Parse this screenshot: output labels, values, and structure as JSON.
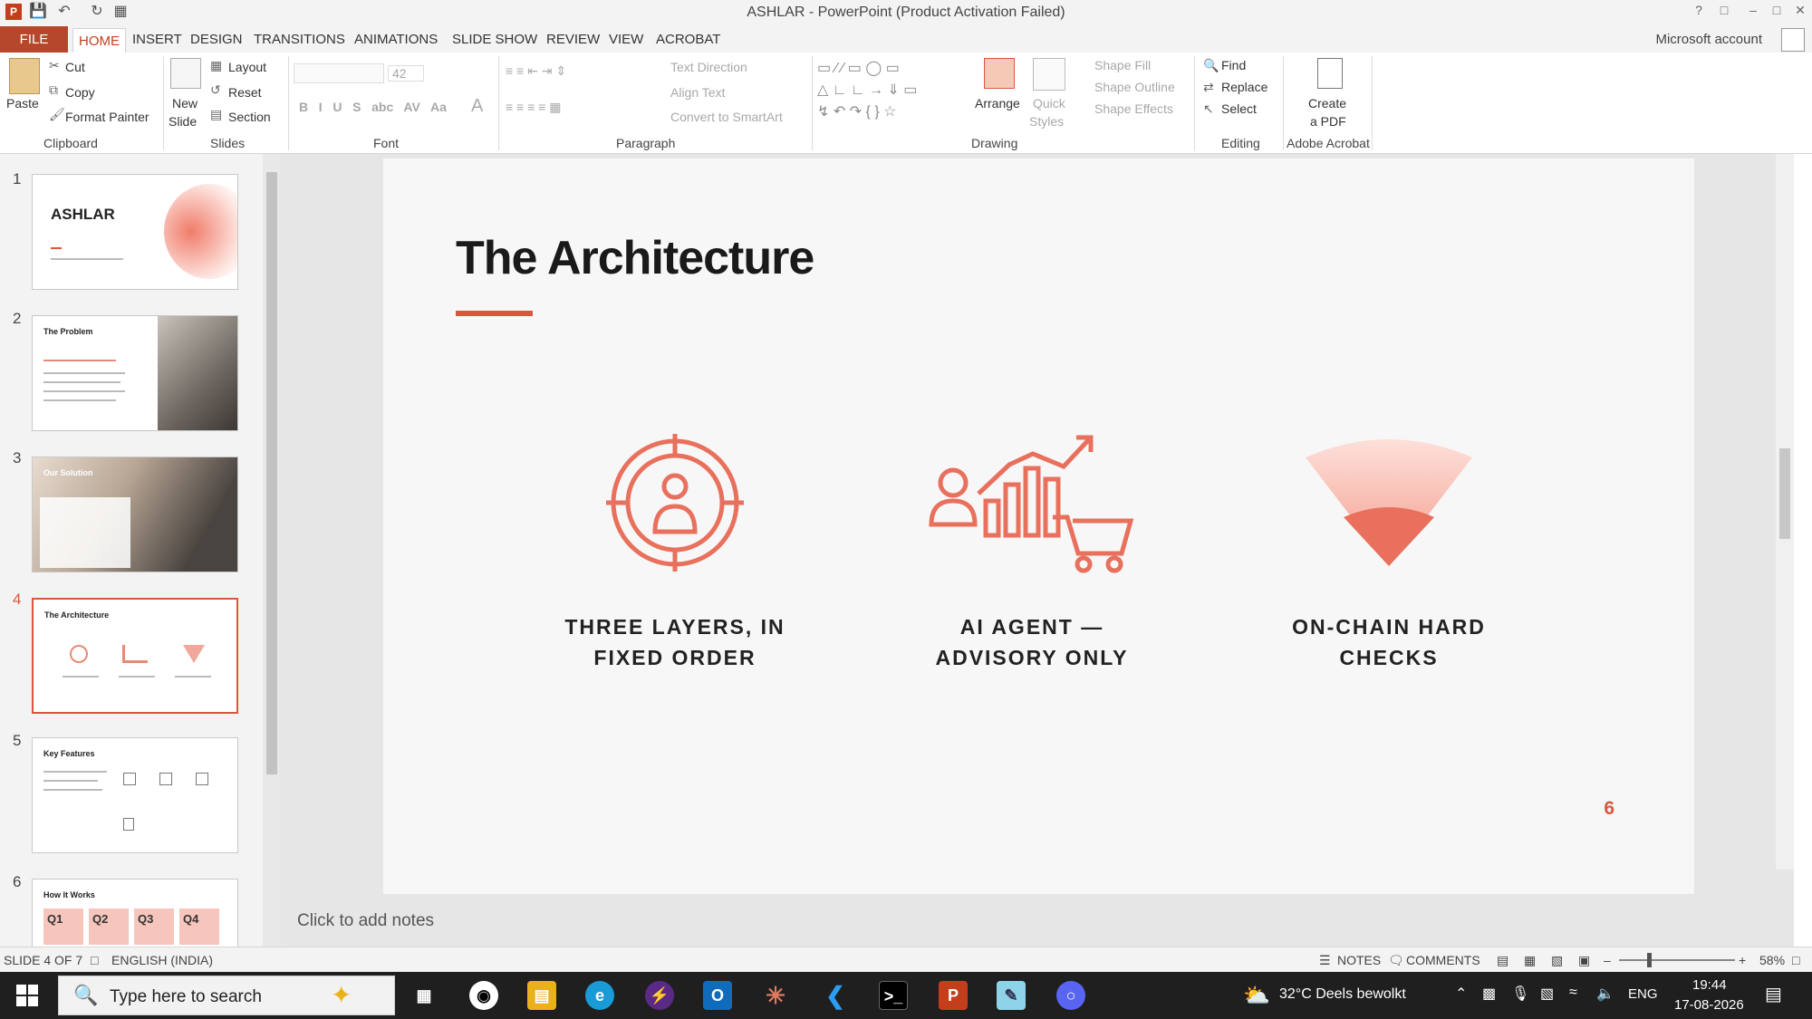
{
  "window": {
    "title": "ASHLAR - PowerPoint (Product Activation Failed)",
    "account": "Microsoft account"
  },
  "tabs": [
    "FILE",
    "HOME",
    "INSERT",
    "DESIGN",
    "TRANSITIONS",
    "ANIMATIONS",
    "SLIDE SHOW",
    "REVIEW",
    "VIEW",
    "ACROBAT"
  ],
  "ribbon": {
    "clipboard": {
      "paste": "Paste",
      "cut": "Cut",
      "copy": "Copy",
      "format_painter": "Format Painter",
      "label": "Clipboard"
    },
    "slides": {
      "new_slide_1": "New",
      "new_slide_2": "Slide",
      "layout": "Layout",
      "reset": "Reset",
      "section": "Section",
      "label": "Slides"
    },
    "font": {
      "size": "42",
      "label": "Font"
    },
    "paragraph": {
      "text_direction": "Text Direction",
      "align_text": "Align Text",
      "smartart": "Convert to SmartArt",
      "label": "Paragraph"
    },
    "drawing": {
      "arrange": "Arrange",
      "quick_1": "Quick",
      "quick_2": "Styles",
      "shape_fill": "Shape Fill",
      "shape_outline": "Shape Outline",
      "shape_effects": "Shape Effects",
      "label": "Drawing"
    },
    "editing": {
      "find": "Find",
      "replace": "Replace",
      "select": "Select",
      "label": "Editing"
    },
    "acrobat": {
      "create_1": "Create",
      "create_2": "a PDF",
      "label": "Adobe Acrobat"
    }
  },
  "thumbnails": [
    {
      "num": "1",
      "title": "ASHLAR"
    },
    {
      "num": "2",
      "title": "The Problem"
    },
    {
      "num": "3",
      "title": "Our Solution"
    },
    {
      "num": "4",
      "title": "The Architecture"
    },
    {
      "num": "5",
      "title": "Key Features"
    },
    {
      "num": "6",
      "title": "How It Works",
      "quarters": [
        "Q1",
        "Q2",
        "Q3",
        "Q4"
      ]
    }
  ],
  "slide": {
    "title": "The Architecture",
    "features": [
      {
        "line1": "THREE LAYERS, IN",
        "line2": "FIXED ORDER",
        "icon": "target-person-icon"
      },
      {
        "line1": "AI AGENT —",
        "line2": "ADVISORY ONLY",
        "icon": "growth-chart-cart-icon"
      },
      {
        "line1": "ON-CHAIN HARD",
        "line2": "CHECKS",
        "icon": "wifi-cone-icon"
      }
    ],
    "page_number": "6",
    "accent": "#d9573b"
  },
  "notes_placeholder": "Click to add notes",
  "status": {
    "slide_info": "SLIDE 4 OF 7",
    "language": "ENGLISH (INDIA)",
    "notes": "NOTES",
    "comments": "COMMENTS",
    "zoom": "58%"
  },
  "taskbar": {
    "search_placeholder": "Type here to search",
    "weather": "32°C  Deels bewolkt",
    "lang": "ENG",
    "time": "19:44",
    "date": "17-08-2026"
  }
}
